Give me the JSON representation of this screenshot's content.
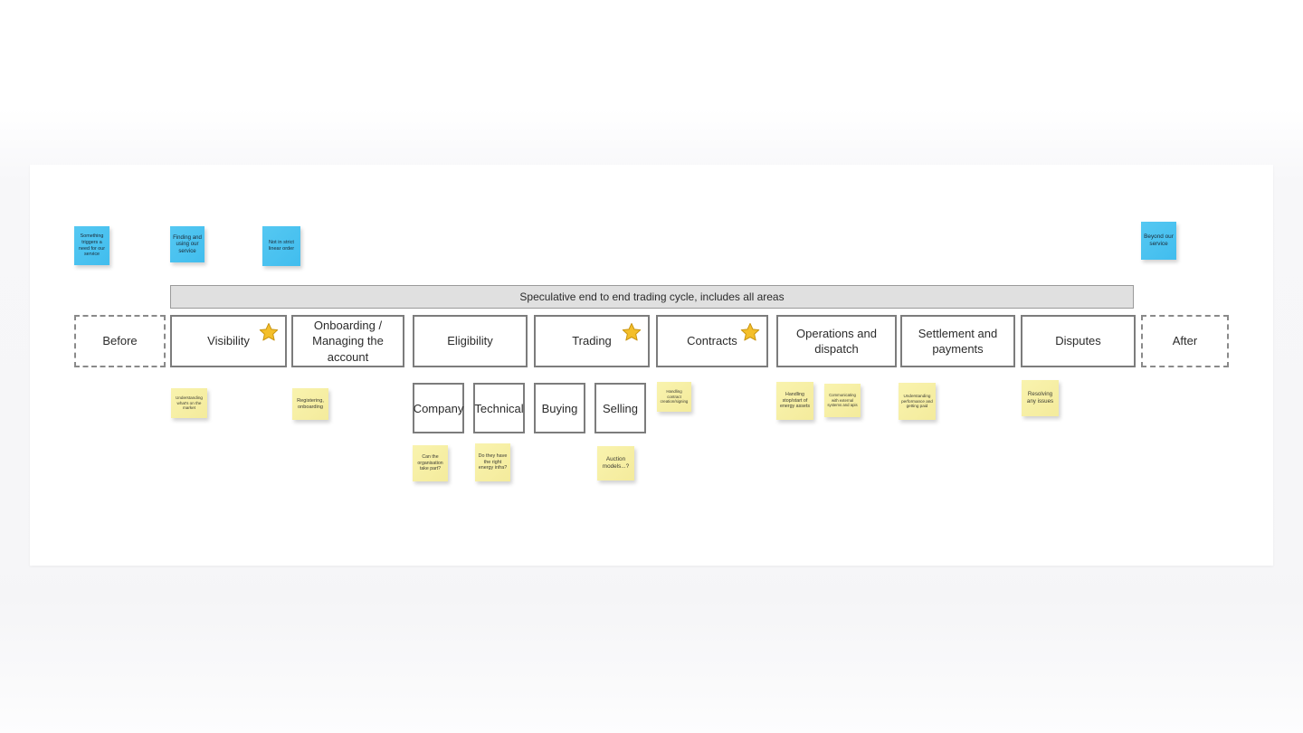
{
  "board": {
    "title": "Speculative end to end trading cycle, includes all areas"
  },
  "context_notes": [
    {
      "text": "Something triggers a need for our service",
      "color": "#4ec3f0"
    },
    {
      "text": "Finding and using our service",
      "color": "#4ec3f0"
    },
    {
      "text": "Not in strict linear order",
      "color": "#4ec3f0"
    },
    {
      "text": "Beyond our service",
      "color": "#4ec3f0"
    }
  ],
  "stages": [
    {
      "label": "Before",
      "starred": false,
      "style": "dashed"
    },
    {
      "label": "Visibility",
      "starred": true,
      "style": "solid"
    },
    {
      "label": "Onboarding / Managing the account",
      "starred": false,
      "style": "solid"
    },
    {
      "label": "Eligibility",
      "starred": false,
      "style": "solid"
    },
    {
      "label": "Trading",
      "starred": true,
      "style": "solid"
    },
    {
      "label": "Contracts",
      "starred": true,
      "style": "solid"
    },
    {
      "label": "Operations and dispatch",
      "starred": false,
      "style": "solid"
    },
    {
      "label": "Settlement and payments",
      "starred": false,
      "style": "solid"
    },
    {
      "label": "Disputes",
      "starred": false,
      "style": "solid"
    },
    {
      "label": "After",
      "starred": false,
      "style": "dashed"
    }
  ],
  "subboxes": [
    {
      "label": "Company"
    },
    {
      "label": "Technical"
    },
    {
      "label": "Buying"
    },
    {
      "label": "Selling"
    }
  ],
  "activity_notes": [
    {
      "text": "Understanding what's on the market"
    },
    {
      "text": "Registering, onboarding"
    },
    {
      "text": "Handling contract creation/signing"
    },
    {
      "text": "Handling stop/start of energy assets"
    },
    {
      "text": "Communicating with external systems and apis"
    },
    {
      "text": "Understanding performance and getting paid"
    },
    {
      "text": "Resolving any issues"
    }
  ],
  "question_notes": [
    {
      "text": "Can the organisation take part?"
    },
    {
      "text": "Do they have the right energy infra?"
    },
    {
      "text": "Auction models...?"
    }
  ],
  "icons": {
    "star": "★"
  },
  "colors": {
    "sticky_blue": "#4ec3f0",
    "sticky_yellow": "#f7f0a8",
    "band_fill": "#e0e0e0",
    "box_border": "#7c7c7c",
    "star_fill": "#f4bf2a",
    "star_stroke": "#c99512"
  }
}
